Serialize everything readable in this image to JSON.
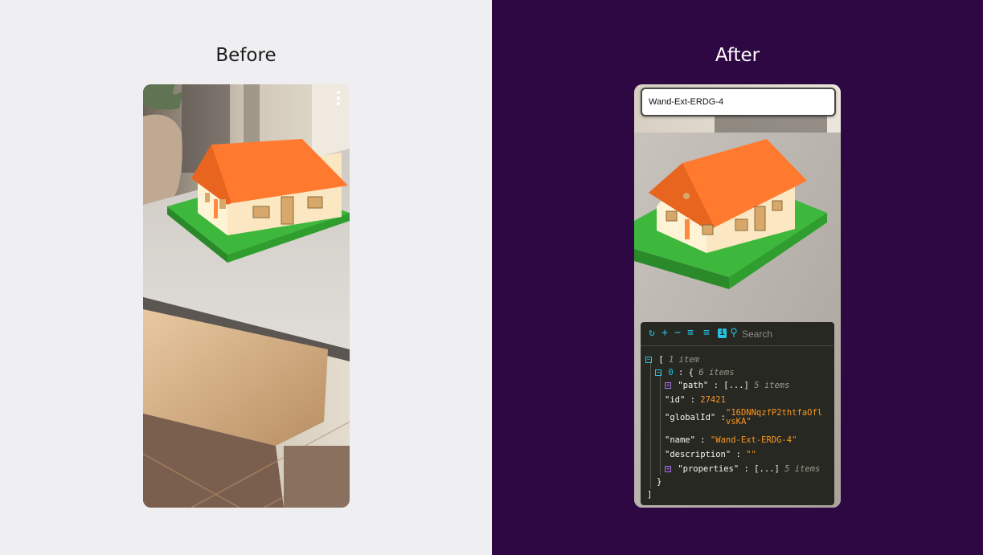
{
  "before": {
    "title": "Before"
  },
  "after": {
    "title": "After",
    "name_input": {
      "value": "Wand-Ext-ERDG-4"
    },
    "json_viewer": {
      "search_placeholder": "Search",
      "root": {
        "bracket_open": "[",
        "count": "1 item",
        "bracket_close": "]"
      },
      "item": {
        "index": "0",
        "brace_open": "{",
        "count": "6 items",
        "brace_close": "}"
      },
      "fields": {
        "path": {
          "key": "\"path\"",
          "value": "[...]",
          "count": "5 items"
        },
        "id": {
          "key": "\"id\"",
          "value": "27421"
        },
        "globalId": {
          "key": "\"globalId\"",
          "value": "\"16DNNqzfP2thtfaOflvsKA\""
        },
        "name": {
          "key": "\"name\"",
          "value": "\"Wand-Ext-ERDG-4\""
        },
        "description": {
          "key": "\"description\"",
          "value": "\"\""
        },
        "properties": {
          "key": "\"properties\"",
          "value": "[...]",
          "count": "5 items"
        }
      }
    }
  },
  "colors": {
    "left_background": "#efeff2",
    "right_background": "#2e0843",
    "roof": "#ff7a2f",
    "grass_base": "#3db83d",
    "house_wall": "#fff3d6",
    "json_background": "#272822",
    "json_accent": "#27c2e3",
    "json_string": "#fd971f"
  },
  "icons": [
    "more-vertical-icon",
    "undo-icon",
    "expand-all-icon",
    "collapse-all-icon",
    "indent-icon",
    "outdent-icon",
    "info-icon",
    "search-icon"
  ]
}
